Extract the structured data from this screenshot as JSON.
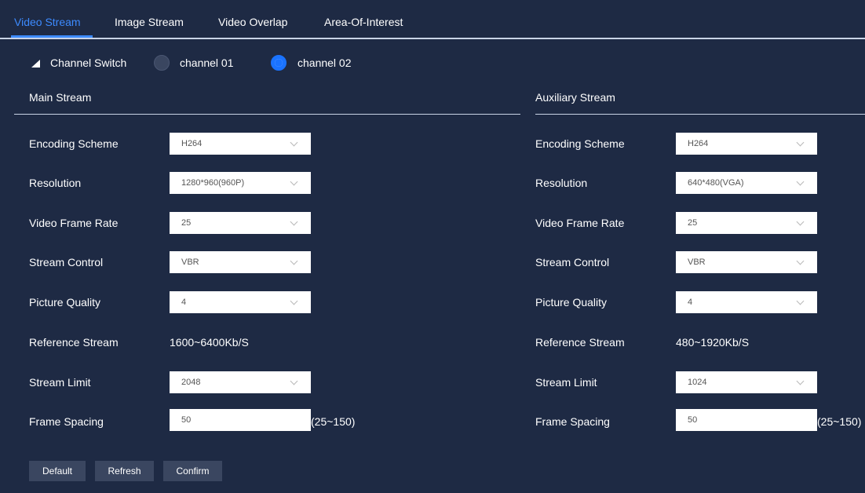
{
  "tabs": [
    {
      "label": "Video Stream",
      "active": true
    },
    {
      "label": "Image Stream",
      "active": false
    },
    {
      "label": "Video Overlap",
      "active": false
    },
    {
      "label": "Area-Of-Interest",
      "active": false
    }
  ],
  "channel_switch": {
    "label": "Channel Switch",
    "options": [
      {
        "label": "channel 01",
        "selected": false
      },
      {
        "label": "channel 02",
        "selected": true
      }
    ]
  },
  "main": {
    "title": "Main Stream",
    "encoding_scheme": {
      "label": "Encoding Scheme",
      "value": "H264"
    },
    "resolution": {
      "label": "Resolution",
      "value": "1280*960(960P)"
    },
    "frame_rate": {
      "label": "Video Frame Rate",
      "value": "25"
    },
    "stream_control": {
      "label": "Stream Control",
      "value": "VBR"
    },
    "picture_quality": {
      "label": "Picture Quality",
      "value": "4"
    },
    "reference_stream": {
      "label": "Reference Stream",
      "value": "1600~6400Kb/S"
    },
    "stream_limit": {
      "label": "Stream Limit",
      "value": "2048"
    },
    "frame_spacing": {
      "label": "Frame Spacing",
      "value": "50",
      "range": "(25~150)"
    }
  },
  "aux": {
    "title": "Auxiliary Stream",
    "encoding_scheme": {
      "label": "Encoding Scheme",
      "value": "H264"
    },
    "resolution": {
      "label": "Resolution",
      "value": "640*480(VGA)"
    },
    "frame_rate": {
      "label": "Video Frame Rate",
      "value": "25"
    },
    "stream_control": {
      "label": "Stream Control",
      "value": "VBR"
    },
    "picture_quality": {
      "label": "Picture Quality",
      "value": "4"
    },
    "reference_stream": {
      "label": "Reference Stream",
      "value": "480~1920Kb/S"
    },
    "stream_limit": {
      "label": "Stream Limit",
      "value": "1024"
    },
    "frame_spacing": {
      "label": "Frame Spacing",
      "value": "50",
      "range": "(25~150)"
    }
  },
  "buttons": {
    "default": "Default",
    "refresh": "Refresh",
    "confirm": "Confirm"
  },
  "colors": {
    "background": "#1e2a44",
    "accent": "#1a73ff",
    "active_tab": "#3d8bff",
    "button": "#3a4660"
  }
}
